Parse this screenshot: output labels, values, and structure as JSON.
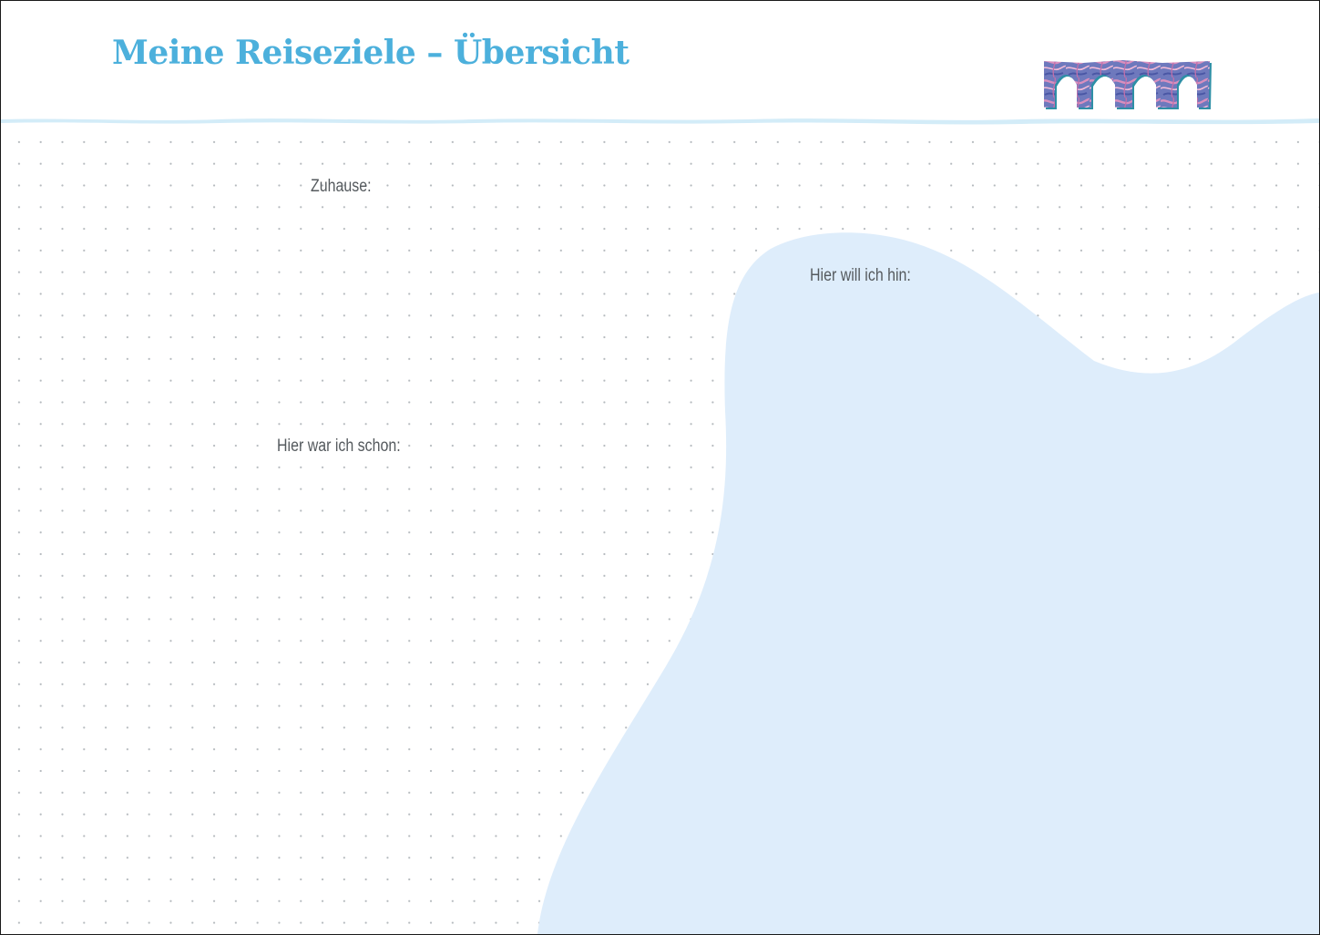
{
  "page": {
    "title": "Meine Reiseziele – Übersicht"
  },
  "sections": {
    "home_label": "Zuhause:",
    "visited_label": "Hier war ich schon:",
    "wishlist_label": "Hier will ich hin:"
  },
  "decoration": {
    "header_icon": "aqueduct-icon",
    "accent_color": "#4cb0dc",
    "header_line_color": "#d3ecf8",
    "wishlist_area_color": "#deedfb",
    "grid_dot_color": "#b4b9bd",
    "label_color": "#555a5e"
  }
}
